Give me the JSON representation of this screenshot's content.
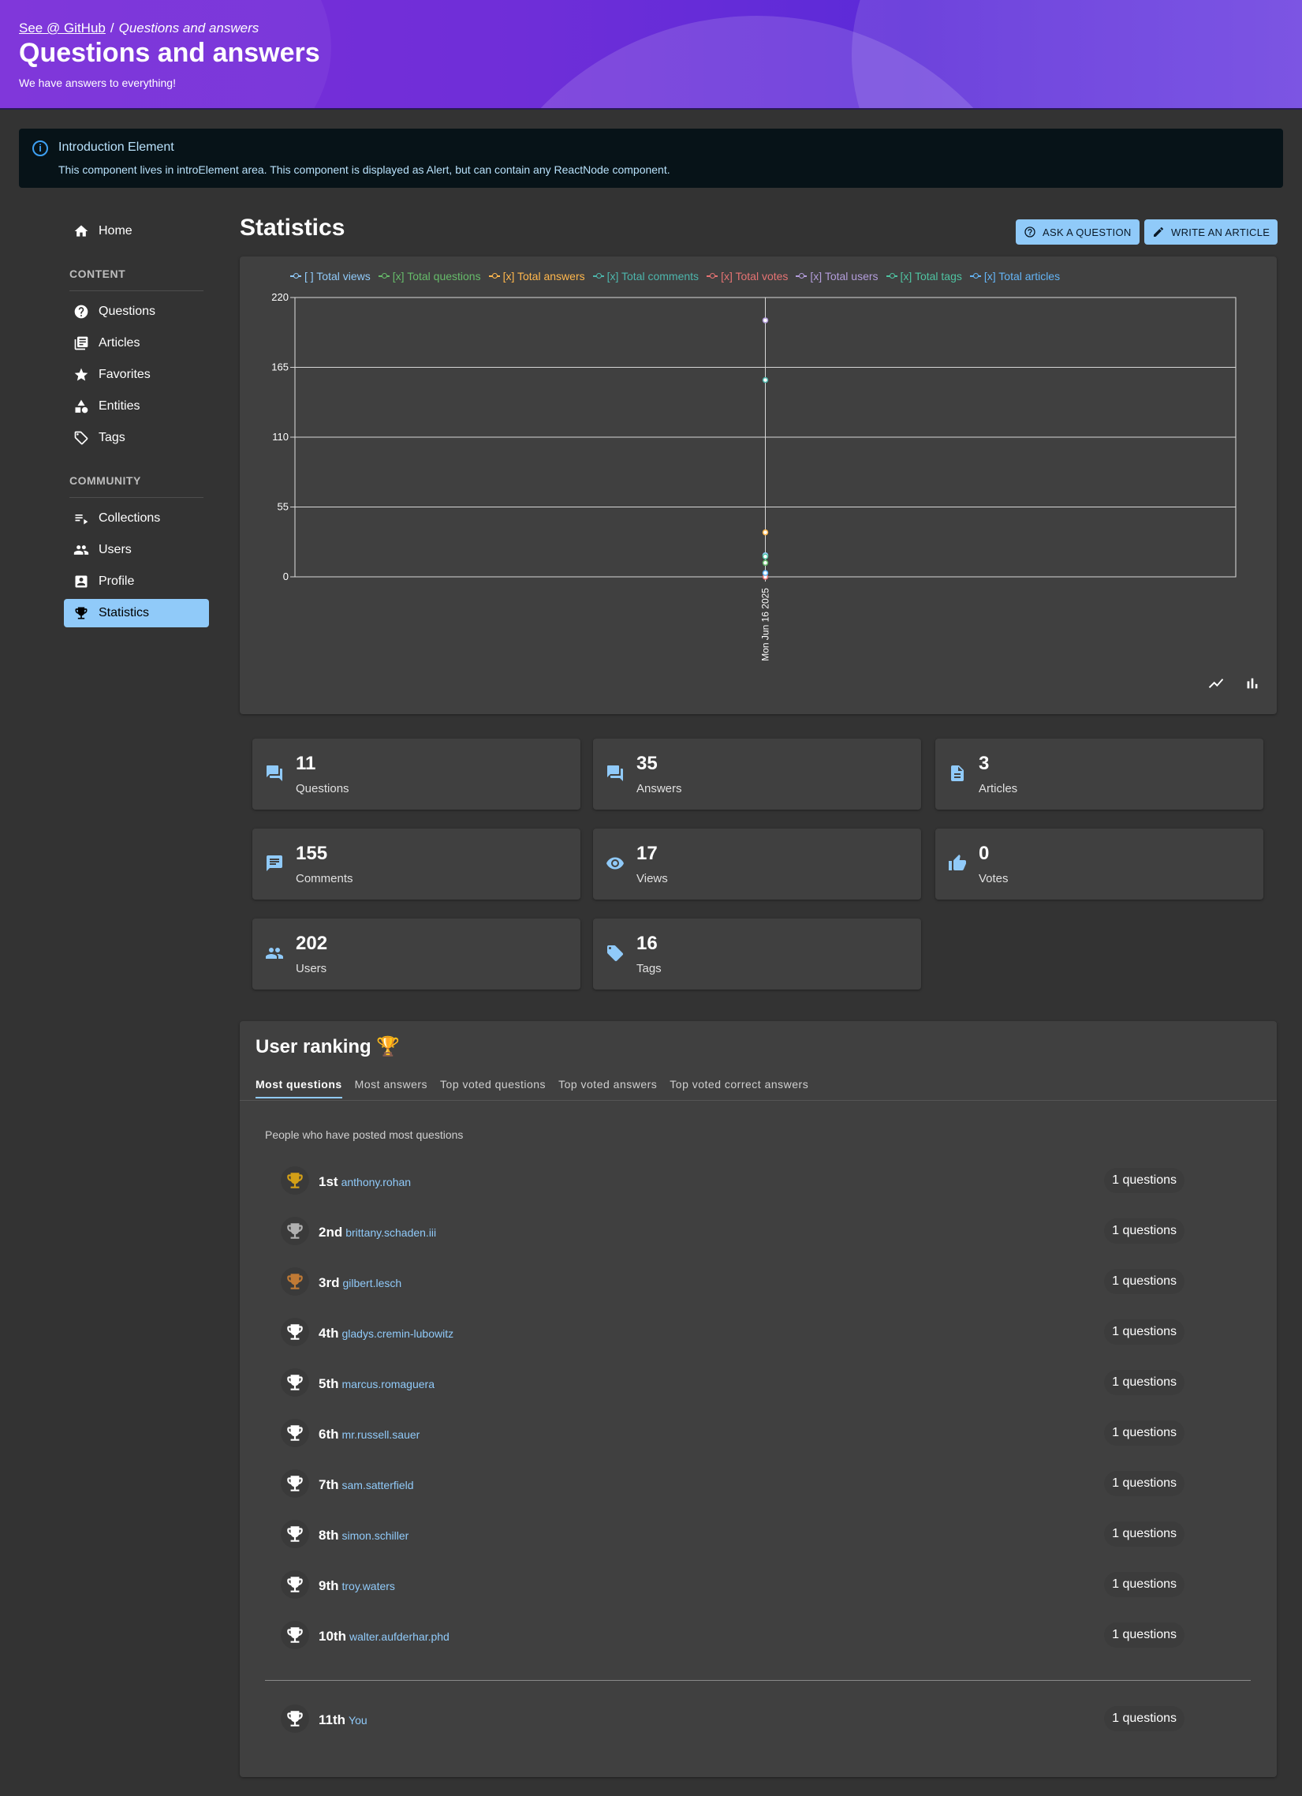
{
  "header": {
    "breadcrumb_link": "See @ GitHub",
    "breadcrumb_sep": "/",
    "breadcrumb_current": "Questions and answers",
    "title": "Questions and answers",
    "subtitle": "We have answers to everything!"
  },
  "intro": {
    "title": "Introduction Element",
    "text": "This component lives in introElement area. This component is displayed as Alert, but can contain any ReactNode component.",
    "icon": "info-icon"
  },
  "sidebar": {
    "home": "Home",
    "content_heading": "CONTENT",
    "content_items": [
      {
        "label": "Questions",
        "icon": "help-circle-icon"
      },
      {
        "label": "Articles",
        "icon": "library-books-icon"
      },
      {
        "label": "Favorites",
        "icon": "star-icon"
      },
      {
        "label": "Entities",
        "icon": "category-icon"
      },
      {
        "label": "Tags",
        "icon": "tag-icon"
      }
    ],
    "community_heading": "COMMUNITY",
    "community_items": [
      {
        "label": "Collections",
        "icon": "playlist-icon"
      },
      {
        "label": "Users",
        "icon": "people-icon"
      },
      {
        "label": "Profile",
        "icon": "account-box-icon"
      },
      {
        "label": "Statistics",
        "icon": "trophy-icon",
        "active": true
      }
    ]
  },
  "main": {
    "title": "Statistics",
    "ask_button": "ASK A QUESTION",
    "write_button": "WRITE AN ARTICLE"
  },
  "chart_data": {
    "type": "line",
    "x": [
      "Mon Jun 16 2025"
    ],
    "ylim": [
      0,
      220
    ],
    "yticks": [
      "0",
      "55",
      "110",
      "165",
      "220"
    ],
    "grid": true,
    "legend_position": "top",
    "series": [
      {
        "name": "[ ] Total views",
        "color": "#90caf9",
        "values": [
          17
        ]
      },
      {
        "name": "[x] Total questions",
        "color": "#66bb6a",
        "values": [
          11
        ]
      },
      {
        "name": "[x] Total answers",
        "color": "#ffb74d",
        "values": [
          35
        ]
      },
      {
        "name": "[x] Total comments",
        "color": "#4db6ac",
        "values": [
          155
        ]
      },
      {
        "name": "[x] Total votes",
        "color": "#e57373",
        "values": [
          0
        ]
      },
      {
        "name": "[x] Total users",
        "color": "#b39ddb",
        "values": [
          202
        ]
      },
      {
        "name": "[x] Total tags",
        "color": "#4fc3a1",
        "values": [
          16
        ]
      },
      {
        "name": "[x] Total articles",
        "color": "#64b5f6",
        "values": [
          3
        ]
      }
    ]
  },
  "stats": [
    {
      "value": "11",
      "label": "Questions",
      "icon": "forum-icon"
    },
    {
      "value": "35",
      "label": "Answers",
      "icon": "forum-icon"
    },
    {
      "value": "3",
      "label": "Articles",
      "icon": "article-icon"
    },
    {
      "value": "155",
      "label": "Comments",
      "icon": "comment-icon"
    },
    {
      "value": "17",
      "label": "Views",
      "icon": "eye-icon"
    },
    {
      "value": "0",
      "label": "Votes",
      "icon": "thumb-up-icon"
    },
    {
      "value": "202",
      "label": "Users",
      "icon": "people-icon"
    },
    {
      "value": "16",
      "label": "Tags",
      "icon": "tag-icon"
    }
  ],
  "ranking": {
    "title": "User ranking 🏆",
    "tabs": [
      "Most questions",
      "Most answers",
      "Top voted questions",
      "Top voted answers",
      "Top voted correct answers"
    ],
    "description": "People who have posted most questions",
    "rows": [
      {
        "pos": "1st",
        "user": "anthony.rohan",
        "count": "1 questions",
        "color": "#d4a017"
      },
      {
        "pos": "2nd",
        "user": "brittany.schaden.iii",
        "count": "1 questions",
        "color": "#b0b0b0"
      },
      {
        "pos": "3rd",
        "user": "gilbert.lesch",
        "count": "1 questions",
        "color": "#c07a35"
      },
      {
        "pos": "4th",
        "user": "gladys.cremin-lubowitz",
        "count": "1 questions",
        "color": "#ffffff"
      },
      {
        "pos": "5th",
        "user": "marcus.romaguera",
        "count": "1 questions",
        "color": "#ffffff"
      },
      {
        "pos": "6th",
        "user": "mr.russell.sauer",
        "count": "1 questions",
        "color": "#ffffff"
      },
      {
        "pos": "7th",
        "user": "sam.satterfield",
        "count": "1 questions",
        "color": "#ffffff"
      },
      {
        "pos": "8th",
        "user": "simon.schiller",
        "count": "1 questions",
        "color": "#ffffff"
      },
      {
        "pos": "9th",
        "user": "troy.waters",
        "count": "1 questions",
        "color": "#ffffff"
      },
      {
        "pos": "10th",
        "user": "walter.aufderhar.phd",
        "count": "1 questions",
        "color": "#ffffff"
      }
    ],
    "self": {
      "pos": "11th",
      "user": "You",
      "count": "1 questions",
      "color": "#ffffff"
    }
  }
}
